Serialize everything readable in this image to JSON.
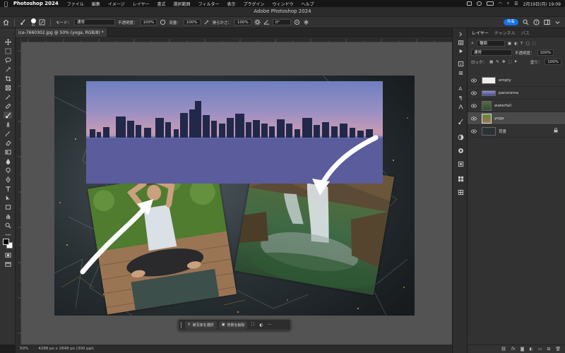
{
  "menubar": {
    "app_name": "Photoshop 2024",
    "items": [
      "ファイル",
      "編集",
      "イメージ",
      "レイヤー",
      "書式",
      "選択範囲",
      "フィルター",
      "表示",
      "プラグイン",
      "ウィンドウ",
      "ヘルプ"
    ],
    "clock": "2月19日(月) 19:09"
  },
  "window": {
    "title": "Adobe Photoshop 2024"
  },
  "options": {
    "brush_size": "81",
    "mode_label": "モード：",
    "mode_value": "通常",
    "opacity_label": "不透明度：",
    "opacity_value": "100%",
    "flow_label": "流量：",
    "flow_value": "100%",
    "smoothing_label": "滑らかさ：",
    "smoothing_value": "100%",
    "angle_value": "0°",
    "share_label": "共有"
  },
  "document": {
    "tab_label": "ice-7660302.jpg @ 50% (yoga, RGB/8) *",
    "close_symbol": "×"
  },
  "status": {
    "zoom": "50%",
    "dimensions": "4288 px x 2848 px (300 ppi)"
  },
  "taskbar": {
    "select_subject": "被写体を選択",
    "remove_bg": "背景を削除",
    "more": "···"
  },
  "panel": {
    "tabs": [
      "レイヤー",
      "チャンネル",
      "パス"
    ],
    "kind_label": "種類",
    "blend_value": "通常",
    "opacity_label": "不透明度：",
    "opacity_value": "100%",
    "lock_label": "ロック：",
    "fill_label": "塗り：",
    "fill_value": "100%",
    "layers": [
      {
        "name": "empty",
        "selected": false
      },
      {
        "name": "panorama",
        "selected": false
      },
      {
        "name": "waterfall",
        "selected": false
      },
      {
        "name": "yoga",
        "selected": true
      },
      {
        "name": "背景",
        "selected": false
      }
    ]
  },
  "colors": {
    "accent": "#1473e6",
    "panel_bg": "#323232",
    "canvas_bg": "#535353"
  }
}
